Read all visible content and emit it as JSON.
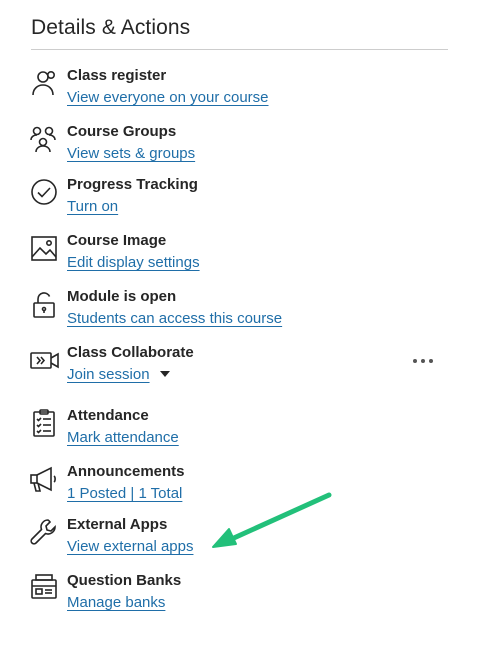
{
  "panel": {
    "title": "Details & Actions"
  },
  "items": [
    {
      "name": "class-register",
      "icon": "person-icon",
      "title": "Class register",
      "link": "View everyone on your course"
    },
    {
      "name": "course-groups",
      "icon": "groups-icon",
      "title": "Course Groups",
      "link": "View sets & groups"
    },
    {
      "name": "progress-tracking",
      "icon": "check-circle-icon",
      "title": "Progress Tracking",
      "link": "Turn on"
    },
    {
      "name": "course-image",
      "icon": "image-icon",
      "title": "Course Image",
      "link": "Edit display settings"
    },
    {
      "name": "module-open",
      "icon": "unlock-icon",
      "title": "Module is open",
      "link": "Students can access this course"
    },
    {
      "name": "class-collaborate",
      "icon": "video-icon",
      "title": "Class Collaborate",
      "link": "Join session"
    },
    {
      "name": "attendance",
      "icon": "clipboard-icon",
      "title": "Attendance",
      "link": "Mark attendance"
    },
    {
      "name": "announcements",
      "icon": "megaphone-icon",
      "title": "Announcements",
      "link": "1 Posted | 1 Total"
    },
    {
      "name": "external-apps",
      "icon": "wrench-icon",
      "title": "External Apps",
      "link": "View external apps"
    },
    {
      "name": "question-banks",
      "icon": "bank-icon",
      "title": "Question Banks",
      "link": "Manage banks"
    }
  ],
  "colors": {
    "link": "#1f6ea8",
    "text": "#262626",
    "annotation_arrow": "#22c07a"
  }
}
